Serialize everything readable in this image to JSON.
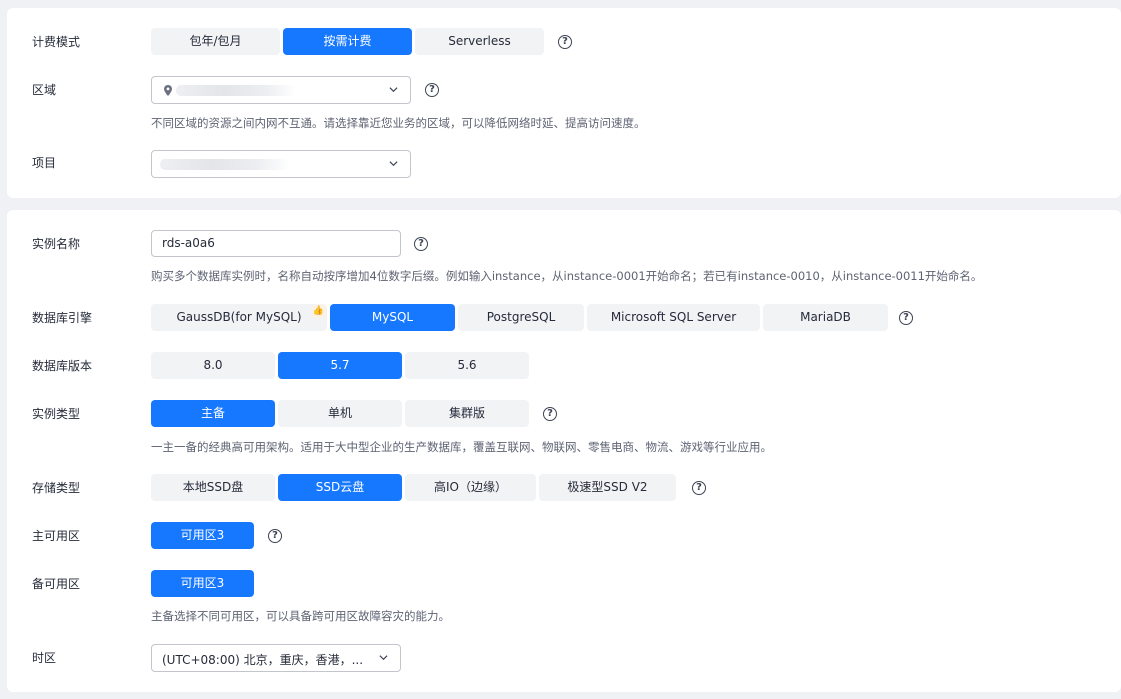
{
  "billing": {
    "label": "计费模式",
    "options": [
      "包年/包月",
      "按需计费",
      "Serverless"
    ],
    "selected": "按需计费"
  },
  "region": {
    "label": "区域",
    "hint": "不同区域的资源之间内网不互通。请选择靠近您业务的区域，可以降低网络时延、提高访问速度。",
    "icon": "location-pin-icon"
  },
  "project": {
    "label": "项目"
  },
  "instance_name": {
    "label": "实例名称",
    "value": "rds-a0a6",
    "hint": "购买多个数据库实例时，名称自动按序增加4位数字后缀。例如输入instance，从instance-0001开始命名；若已有instance-0010，从instance-0011开始命名。"
  },
  "engine": {
    "label": "数据库引擎",
    "options": [
      "GaussDB(for MySQL)",
      "MySQL",
      "PostgreSQL",
      "Microsoft SQL Server",
      "MariaDB"
    ],
    "selected": "MySQL",
    "recommend_icon": "thumbs-up-icon"
  },
  "version": {
    "label": "数据库版本",
    "options": [
      "8.0",
      "5.7",
      "5.6"
    ],
    "selected": "5.7"
  },
  "instance_type": {
    "label": "实例类型",
    "options": [
      "主备",
      "单机",
      "集群版"
    ],
    "selected": "主备",
    "hint": "一主一备的经典高可用架构。适用于大中型企业的生产数据库，覆盖互联网、物联网、零售电商、物流、游戏等行业应用。"
  },
  "storage": {
    "label": "存储类型",
    "options": [
      "本地SSD盘",
      "SSD云盘",
      "高IO（边缘）",
      "极速型SSD V2"
    ],
    "selected": "SSD云盘"
  },
  "primary_az": {
    "label": "主可用区",
    "value": "可用区3"
  },
  "standby_az": {
    "label": "备可用区",
    "value": "可用区3",
    "hint": "主备选择不同可用区，可以具备跨可用区故障容灾的能力。"
  },
  "timezone": {
    "label": "时区",
    "value": "(UTC+08:00) 北京，重庆，香港，..."
  },
  "help_glyph": "?",
  "colors": {
    "accent": "#1677ff",
    "segment_bg": "#f2f3f5",
    "page_bg": "#f0f1f5"
  }
}
